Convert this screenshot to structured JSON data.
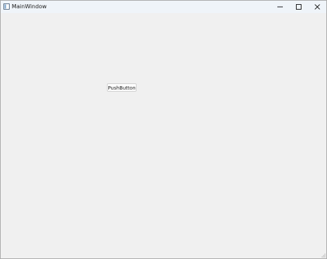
{
  "window": {
    "title": "MainWindow",
    "app_icon": "app-window-icon",
    "caption_buttons": {
      "minimize_icon": "minimize-icon",
      "maximize_icon": "maximize-icon",
      "close_icon": "close-icon"
    }
  },
  "main": {
    "push_button_label": "PushButton"
  },
  "statusbar": {
    "size_grip_icon": "size-grip-icon"
  },
  "colors": {
    "titlebar_bg": "#eff4f9",
    "client_bg": "#f0f0f0",
    "button_bg": "#fdfdfd",
    "button_border": "#d0d0d0"
  }
}
